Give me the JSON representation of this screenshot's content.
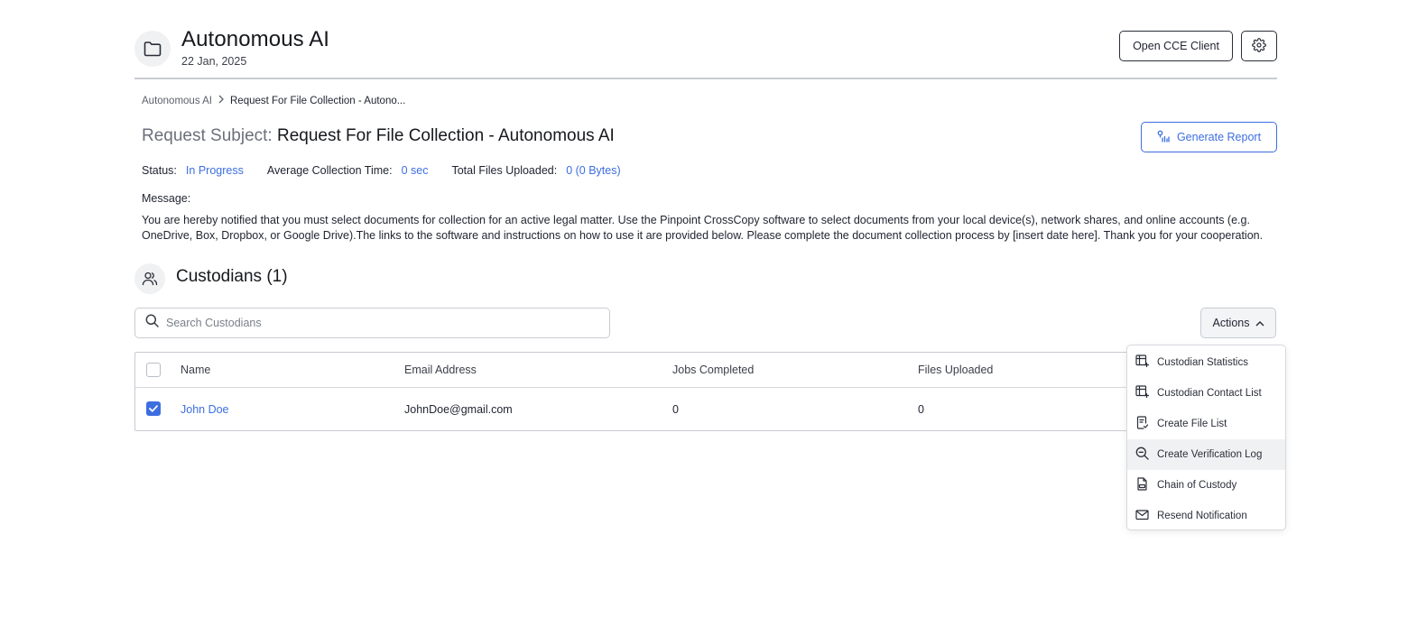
{
  "header": {
    "title": "Autonomous AI",
    "date": "22 Jan, 2025",
    "open_cce_label": "Open CCE Client"
  },
  "breadcrumb": {
    "root": "Autonomous AI",
    "current": "Request For File Collection - Autono..."
  },
  "request": {
    "subject_label": "Request Subject:",
    "subject_value": "Request For File Collection - Autonomous AI",
    "generate_report_label": "Generate Report",
    "status_label": "Status:",
    "status_value": "In Progress",
    "avg_time_label": "Average Collection Time:",
    "avg_time_value": "0 sec",
    "total_files_label": "Total Files Uploaded:",
    "total_files_value": "0 (0 Bytes)",
    "message_label": "Message:",
    "message_body": "You are hereby notified that you must select documents for collection for an active legal matter. Use the Pinpoint CrossCopy software to select documents from your local device(s), network shares, and online accounts (e.g. OneDrive, Box, Dropbox, or Google Drive).The links to the software and instructions on how to use it are provided below. Please complete the document collection process by [insert date here]. Thank you for your cooperation."
  },
  "custodians": {
    "title": "Custodians (1)",
    "search_placeholder": "Search Custodians",
    "actions_label": "Actions",
    "columns": [
      "Name",
      "Email Address",
      "Jobs Completed",
      "Files Uploaded"
    ],
    "rows": [
      {
        "name": "John Doe",
        "email": "JohnDoe@gmail.com",
        "jobs_completed": "0",
        "files_uploaded": "0",
        "checked": true
      }
    ]
  },
  "actions_menu": {
    "items": [
      {
        "label": "Custodian Statistics",
        "icon": "table-plus-icon"
      },
      {
        "label": "Custodian Contact List",
        "icon": "table-plus-icon"
      },
      {
        "label": "Create File List",
        "icon": "file-list-icon"
      },
      {
        "label": "Create Verification Log",
        "icon": "search-zoom-icon"
      },
      {
        "label": "Chain of Custody",
        "icon": "document-icon"
      },
      {
        "label": "Resend Notification",
        "icon": "mail-icon"
      }
    ],
    "highlighted_index": 3
  },
  "colors": {
    "accent": "#3d6ee0",
    "border": "#c8cbd1",
    "text": "#1f2330"
  }
}
